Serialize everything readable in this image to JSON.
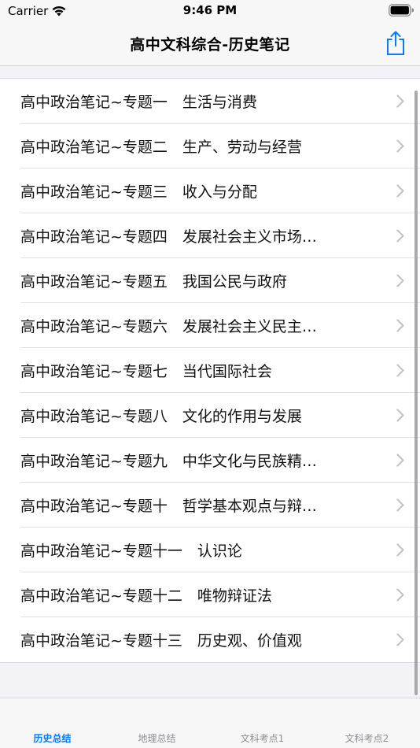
{
  "status_bar": {
    "carrier": "Carrier",
    "time": "9:46 PM"
  },
  "nav": {
    "title": "高中文科综合-历史笔记",
    "share_icon": "share-icon"
  },
  "list": {
    "items": [
      {
        "label": "高中政治笔记~专题一　生活与消费"
      },
      {
        "label": "高中政治笔记~专题二　生产、劳动与经营"
      },
      {
        "label": "高中政治笔记~专题三　收入与分配"
      },
      {
        "label": "高中政治笔记~专题四　发展社会主义市场…"
      },
      {
        "label": "高中政治笔记~专题五　我国公民与政府"
      },
      {
        "label": "高中政治笔记~专题六　发展社会主义民主…"
      },
      {
        "label": "高中政治笔记~专题七　当代国际社会"
      },
      {
        "label": "高中政治笔记~专题八　文化的作用与发展"
      },
      {
        "label": "高中政治笔记~专题九　中华文化与民族精…"
      },
      {
        "label": "高中政治笔记~专题十　哲学基本观点与辩…"
      },
      {
        "label": "高中政治笔记~专题十一　认识论"
      },
      {
        "label": "高中政治笔记~专题十二　唯物辩证法"
      },
      {
        "label": "高中政治笔记~专题十三　历史观、价值观"
      }
    ]
  },
  "tabs": [
    {
      "label": "历史总结",
      "active": true
    },
    {
      "label": "地理总结",
      "active": false
    },
    {
      "label": "文科考点1",
      "active": false
    },
    {
      "label": "文科考点2",
      "active": false
    }
  ],
  "colors": {
    "accent": "#0a7aff",
    "tab_inactive": "#8e8e93",
    "background": "#f2f2f7"
  }
}
